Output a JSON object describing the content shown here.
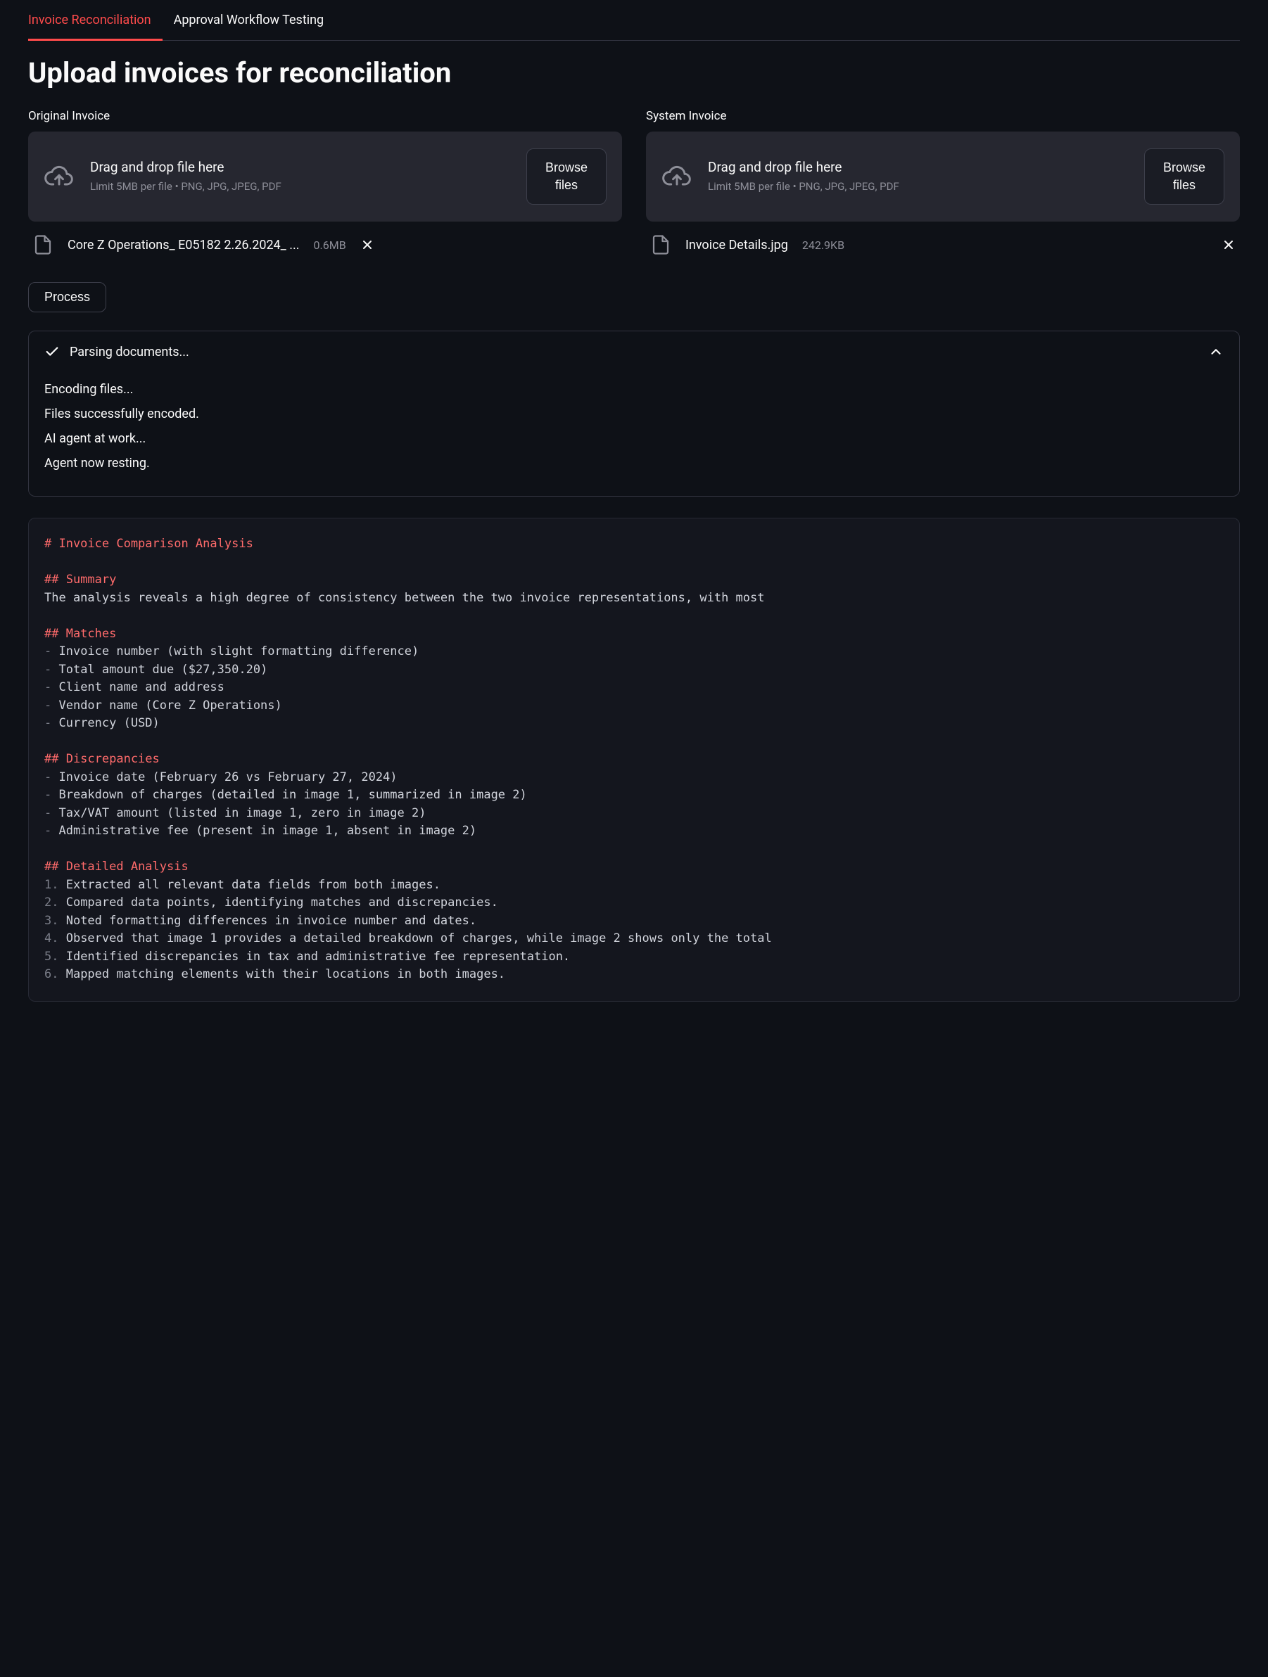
{
  "tabs": {
    "reconciliation": "Invoice Reconciliation",
    "approval": "Approval Workflow Testing"
  },
  "page_title": "Upload invoices for reconciliation",
  "upload_original": {
    "label": "Original Invoice",
    "dz_line1": "Drag and drop file here",
    "dz_line2": "Limit 5MB per file • PNG, JPG, JPEG, PDF",
    "browse": "Browse\nfiles",
    "file_name": "Core Z Operations_ E05182 2.26.2024_ ...",
    "file_size": "0.6MB"
  },
  "upload_system": {
    "label": "System Invoice",
    "dz_line1": "Drag and drop file here",
    "dz_line2": "Limit 5MB per file • PNG, JPG, JPEG, PDF",
    "browse": "Browse\nfiles",
    "file_name": "Invoice Details.jpg",
    "file_size": "242.9KB"
  },
  "process_label": "Process",
  "expander": {
    "title": "Parsing documents...",
    "lines": {
      "l1": "Encoding files...",
      "l2": "Files successfully encoded.",
      "l3": "AI agent at work...",
      "l4": "Agent now resting."
    }
  },
  "report": {
    "title": "# Invoice Comparison Analysis",
    "summary_h": "## Summary",
    "summary_body": "The analysis reveals a high degree of consistency between the two invoice representations, with most",
    "matches_h": "## Matches",
    "matches": {
      "m1": "Invoice number (with slight formatting difference)",
      "m2": "Total amount due ($27,350.20)",
      "m3": "Client name and address",
      "m4": "Vendor name (Core Z Operations)",
      "m5": "Currency (USD)"
    },
    "disc_h": "## Discrepancies",
    "disc": {
      "d1": "Invoice date (February 26 vs February 27, 2024)",
      "d2": "Breakdown of charges (detailed in image 1, summarized in image 2)",
      "d3": "Tax/VAT amount (listed in image 1, zero in image 2)",
      "d4": "Administrative fee (present in image 1, absent in image 2)"
    },
    "det_h": "## Detailed Analysis",
    "det": {
      "n1": "Extracted all relevant data fields from both images.",
      "n2": "Compared data points, identifying matches and discrepancies.",
      "n3": "Noted formatting differences in invoice number and dates.",
      "n4": "Observed that image 1 provides a detailed breakdown of charges, while image 2 shows only the total",
      "n5": "Identified discrepancies in tax and administrative fee representation.",
      "n6": "Mapped matching elements with their locations in both images."
    }
  }
}
